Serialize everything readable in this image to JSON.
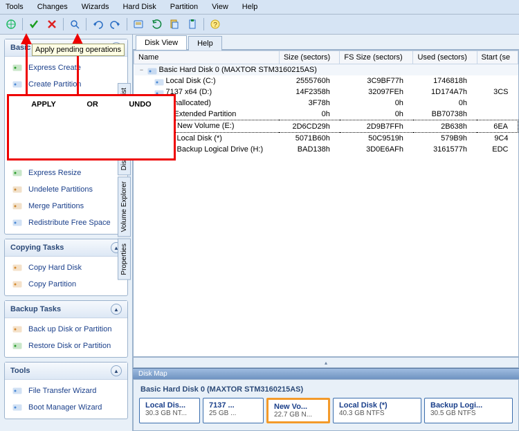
{
  "menu": {
    "items": [
      "Tools",
      "Changes",
      "Wizards",
      "Hard Disk",
      "Partition",
      "View",
      "Help"
    ]
  },
  "tooltip": "Apply pending operations",
  "overlay": {
    "apply": "APPLY",
    "or": "OR",
    "undo": "UNDO"
  },
  "panels": {
    "basic": {
      "title": "Basic",
      "tasks": [
        {
          "label": "Express Create",
          "icon": "express-create-icon"
        },
        {
          "label": "Create Partition",
          "icon": "create-partition-icon"
        },
        {
          "label": "Express Resize",
          "icon": "express-resize-icon"
        },
        {
          "label": "Undelete Partitions",
          "icon": "undelete-icon"
        },
        {
          "label": "Merge Partitions",
          "icon": "merge-icon"
        },
        {
          "label": "Redistribute Free Space",
          "icon": "redistribute-icon"
        }
      ]
    },
    "copying": {
      "title": "Copying Tasks",
      "tasks": [
        {
          "label": "Copy Hard Disk",
          "icon": "copy-disk-icon"
        },
        {
          "label": "Copy Partition",
          "icon": "copy-partition-icon"
        }
      ]
    },
    "backup": {
      "title": "Backup Tasks",
      "tasks": [
        {
          "label": "Back up Disk or Partition",
          "icon": "backup-icon"
        },
        {
          "label": "Restore Disk or Partition",
          "icon": "restore-icon"
        }
      ]
    },
    "tools": {
      "title": "Tools",
      "tasks": [
        {
          "label": "File Transfer Wizard",
          "icon": "file-transfer-icon"
        },
        {
          "label": "Boot Manager Wizard",
          "icon": "boot-mgr-icon"
        }
      ]
    }
  },
  "view_tabs": {
    "active": "Disk View",
    "help": "Help"
  },
  "side_tabs": [
    "Partition List",
    "Disk Editor",
    "Volume Explorer",
    "Properties"
  ],
  "grid": {
    "headers": [
      "Name",
      "Size (sectors)",
      "FS Size (sectors)",
      "Used (sectors)",
      "Start (se"
    ],
    "disk": "Basic Hard Disk 0 (MAXTOR STM3160215AS)",
    "rows": [
      {
        "indent": 1,
        "name": "Local Disk (C:)",
        "icon": "drive-icon",
        "size": "2555760h",
        "fs": "3C9BF77h",
        "used": "1746818h",
        "start": ""
      },
      {
        "indent": 1,
        "name": "7137 x64 (D:)",
        "icon": "drive-icon",
        "size": "14F2358h",
        "fs": "32097FEh",
        "used": "1D174A7h",
        "start": "3CS"
      },
      {
        "indent": 1,
        "name": "(Unallocated)",
        "icon": "unalloc-icon",
        "size": "3F78h",
        "fs": "0h",
        "used": "0h",
        "start": ""
      },
      {
        "indent": 1,
        "name": "Extended Partition",
        "icon": "ext-icon",
        "size": "0h",
        "fs": "0h",
        "used": "BB70738h",
        "start": "",
        "tw": "-"
      },
      {
        "indent": 2,
        "name": "New Volume (E:)",
        "icon": "drive-icon",
        "size": "2D6CD29h",
        "fs": "2D9B7FFh",
        "used": "2B638h",
        "start": "6EA",
        "sel": true
      },
      {
        "indent": 2,
        "name": "Local Disk (*)",
        "icon": "drive-icon",
        "size": "5071B60h",
        "fs": "50C9519h",
        "used": "579B9h",
        "start": "9C4"
      },
      {
        "indent": 2,
        "name": "Backup Logical Drive (H:)",
        "icon": "drive-icon",
        "size": "BAD138h",
        "fs": "3D0E6AFh",
        "used": "3161577h",
        "start": "EDC"
      }
    ]
  },
  "diskmap": {
    "header": "Disk Map",
    "title": "Basic Hard Disk 0 (MAXTOR STM3160215AS)",
    "blocks": [
      {
        "t": "Local Dis...",
        "s": "30.3 GB NT..."
      },
      {
        "t": "7137 ...",
        "s": "25 GB ..."
      },
      {
        "t": "New Vo...",
        "s": "22.7 GB N...",
        "sel": true
      },
      {
        "t": "Local Disk (*)",
        "s": "40.3 GB NTFS"
      },
      {
        "t": "Backup Logi...",
        "s": "30.5 GB NTFS"
      }
    ]
  }
}
